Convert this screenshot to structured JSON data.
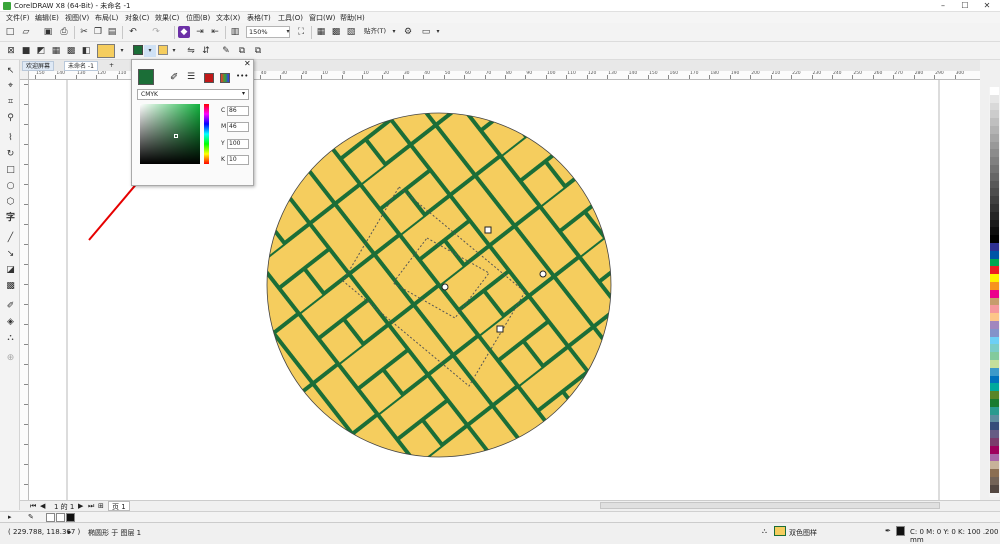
{
  "window": {
    "title": "CorelDRAW X8 (64-Bit) - 未命名 -1",
    "controls": [
      "–",
      "☐",
      "✕"
    ]
  },
  "menu": {
    "items": [
      "文件(F)",
      "编辑(E)",
      "视图(V)",
      "布局(L)",
      "对象(C)",
      "效果(C)",
      "位图(B)",
      "文本(X)",
      "表格(T)",
      "工具(O)",
      "窗口(W)",
      "帮助(H)"
    ]
  },
  "toolbar": {
    "zoom_value": "150%",
    "snap_label": "贴齐(T)"
  },
  "tabs": {
    "welcome": "欢迎屏幕",
    "document": "未命名 -1",
    "add": "+"
  },
  "ruler": {
    "labels": [
      "150",
      "140",
      "130",
      "120",
      "110",
      "100",
      "90",
      "80",
      "70",
      "60",
      "50",
      "40",
      "30",
      "20",
      "10",
      "0",
      "10",
      "20",
      "30",
      "40",
      "50",
      "60",
      "70",
      "80",
      "90",
      "100",
      "110",
      "120",
      "130",
      "140",
      "150",
      "160",
      "170",
      "180",
      "190",
      "200",
      "210",
      "220",
      "230",
      "240",
      "250",
      "260",
      "270",
      "280",
      "290",
      "300"
    ]
  },
  "color_popup": {
    "model": "CMYK",
    "close": "✕",
    "more": "•••",
    "channels": [
      {
        "label": "C",
        "value": "86"
      },
      {
        "label": "M",
        "value": "46"
      },
      {
        "label": "Y",
        "value": "100"
      },
      {
        "label": "K",
        "value": "10"
      }
    ]
  },
  "pages": {
    "counter": "1 的 1",
    "page_tab": "页 1"
  },
  "status": {
    "coords": "( 229.788, 118.367 )",
    "object_info": "椭圆形 于 图层 1",
    "fill_type": "双色图样",
    "outline_info": "C: 0 M: 0 Y: 0 K: 100 .200 mm"
  },
  "colors": {
    "fg_green": "#1b6e37",
    "bg_yellow": "#f5cd5e",
    "annotation_red": "#e60000"
  },
  "icons": [
    "new-icon",
    "open-icon",
    "save-icon",
    "print-icon",
    "cut-icon",
    "copy-icon",
    "paste-icon",
    "undo-icon",
    "redo-icon",
    "import-icon",
    "export-icon",
    "zoom-dropdown-icon",
    "fullscreen-icon",
    "snap-icon",
    "settings-icon",
    "eyedropper-icon",
    "close-icon"
  ]
}
